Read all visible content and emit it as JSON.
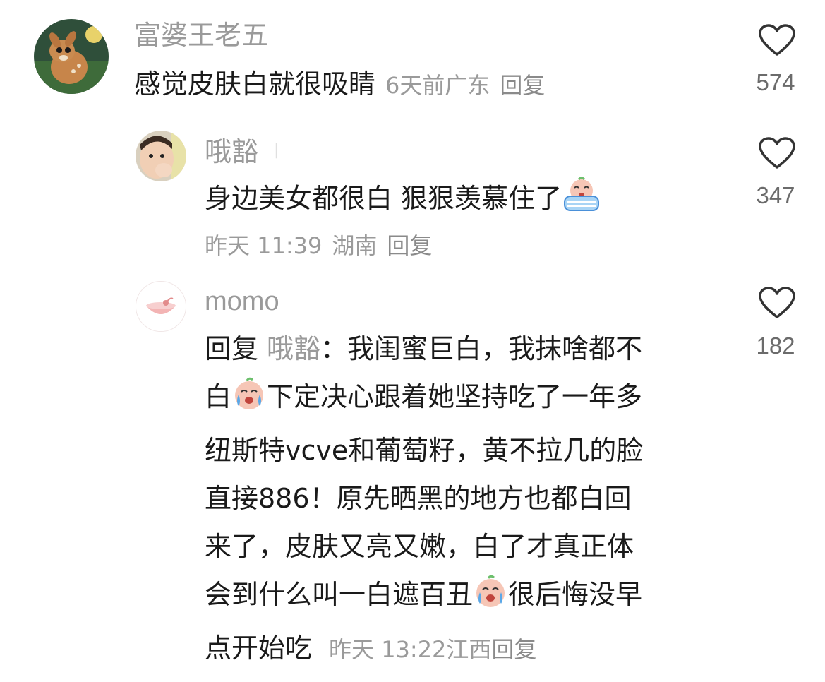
{
  "comments": [
    {
      "username": "富婆王老五",
      "text": "感觉皮肤白就很吸睛",
      "time": "6天前",
      "location": "广东",
      "reply_label": "回复",
      "likes": "574"
    }
  ],
  "replies": [
    {
      "username": "哦豁",
      "text_a": "身边美女都很白 狠狠羡慕住了",
      "time": "昨天 11:39",
      "location": "湖南",
      "reply_label": "回复",
      "likes": "347"
    },
    {
      "username": "momo",
      "reply_prefix": "回复",
      "mention": "哦豁",
      "colon": "：",
      "line1": "我闺蜜巨白，我抹啥都不",
      "line2_a": "白",
      "line2_b": "下定决心跟着她坚持吃了一年多",
      "line3": "纽斯特vcve和葡萄籽，黄不拉几的脸",
      "line4": "直接886！原先晒黑的地方也都白回",
      "line5": "来了，皮肤又亮又嫩，白了才真正体",
      "line6_a": "会到什么叫一白遮百丑",
      "line6_b": "很后悔没早",
      "line7": "点开始吃",
      "time": "昨天 13:22",
      "location": "江西",
      "reply_label": "回复",
      "likes": "182"
    }
  ],
  "icons": {
    "heart": "heart-outline-icon",
    "crying_emoji": "crying-face-emoji",
    "crying_tub_emoji": "crying-tub-emoji"
  },
  "colors": {
    "text": "#1a1a1a",
    "secondary": "#9a9a9a",
    "icon": "#333333"
  }
}
